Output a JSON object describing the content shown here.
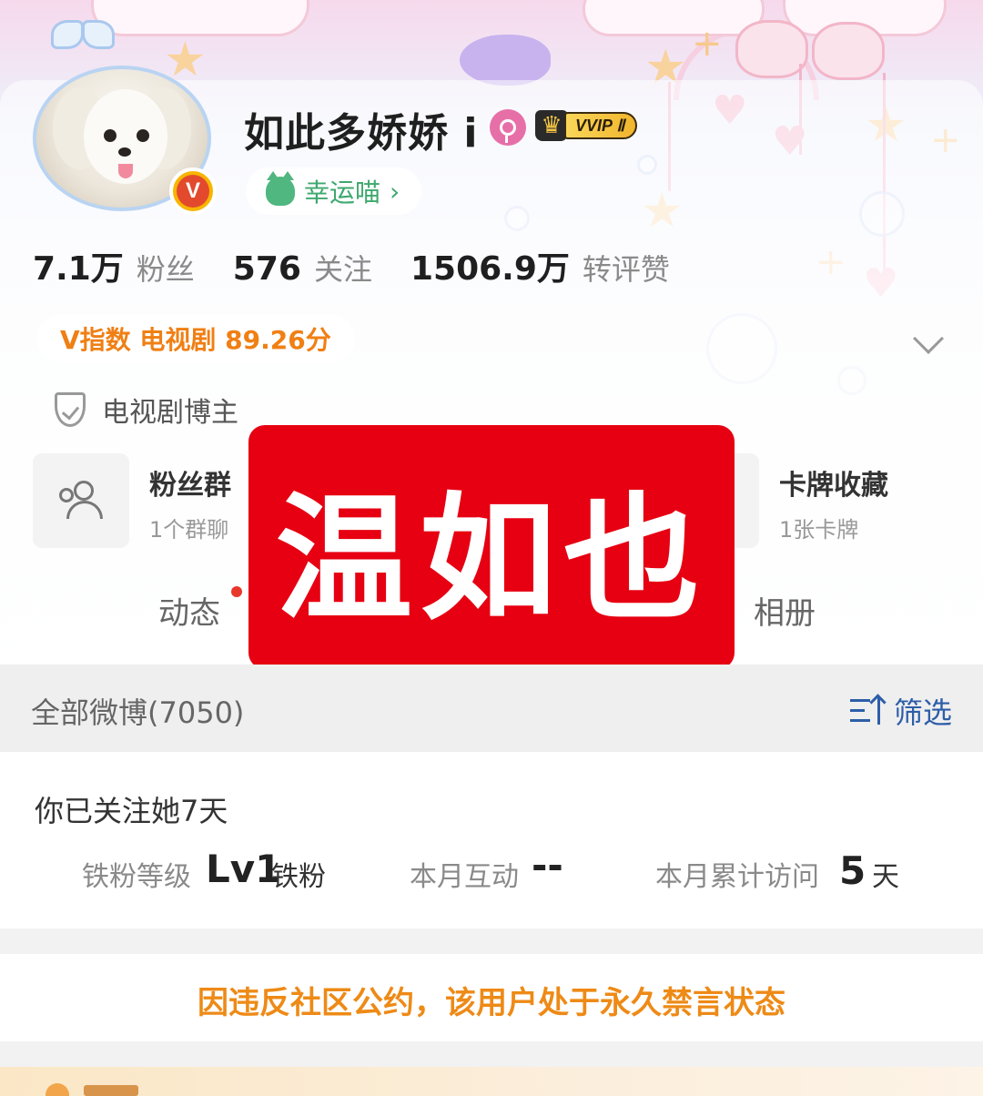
{
  "profile": {
    "name": "如此多娇娇 i",
    "vip_level": "VVIP Ⅱ",
    "lucky_label": "幸运喵",
    "lucky_chevron": "›",
    "verified_mark": "V"
  },
  "stats": [
    {
      "value": "7.1万",
      "label": "粉丝"
    },
    {
      "value": "576",
      "label": "关注"
    },
    {
      "value": "1506.9万",
      "label": "转评赞"
    }
  ],
  "vindex": "V指数 电视剧 89.26分",
  "blogger_tag": "电视剧博主",
  "cards": {
    "fan_group": {
      "title": "粉丝群",
      "sub": "1个群聊"
    },
    "card_collection": {
      "title": "卡牌收藏",
      "sub": "1张卡牌"
    }
  },
  "tabs": {
    "dynamic": "动态",
    "album": "相册"
  },
  "overlay_sticker": "温如也",
  "feed": {
    "title": "全部微博(7050)",
    "filter_label": "筛选"
  },
  "follow_info": {
    "title": "你已关注她7天",
    "iron_fan_label": "铁粉等级",
    "iron_fan_level": "Lv1",
    "iron_fan_suffix": "铁粉",
    "monthly_interaction_label": "本月互动",
    "monthly_interaction_value": "--",
    "monthly_visits_label": "本月累计访问",
    "monthly_visits_value": "5",
    "monthly_visits_unit": "天"
  },
  "ban_notice": "因违反社区公约，该用户处于永久禁言状态",
  "colors": {
    "accent_orange": "#f07f14",
    "link_blue": "#2d5ea8",
    "sticker_red": "#e60012",
    "ban_orange": "#ee8a16"
  },
  "icons": [
    "female-icon",
    "crown-icon",
    "cat-icon",
    "chevron-down-icon",
    "shield-check-icon",
    "people-icon",
    "filter-sort-icon"
  ]
}
